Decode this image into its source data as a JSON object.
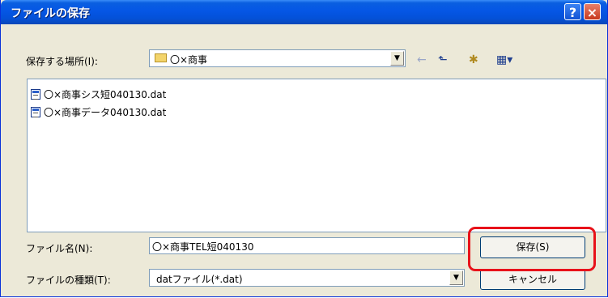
{
  "dialog": {
    "title": "ファイルの保存",
    "help_button": "?",
    "close_button": "×"
  },
  "location": {
    "label": "保存する場所(I):",
    "value": "〇×商事"
  },
  "toolbar": {
    "back_glyph": "←",
    "up_glyph": "⬑",
    "new_folder_glyph": "✱",
    "views_glyph": "▦▾"
  },
  "files": [
    {
      "name": "〇×商事シス短040130.dat"
    },
    {
      "name": "〇×商事データ040130.dat"
    }
  ],
  "filename": {
    "label": "ファイル名(N):",
    "value": "〇×商事TEL短040130"
  },
  "filetype": {
    "label": "ファイルの種類(T):",
    "value": "datファイル(*.dat)"
  },
  "buttons": {
    "save": "保存(S)",
    "cancel": "キャンセル"
  },
  "colors": {
    "titlebar": "#0556e5",
    "dialog_bg": "#ece9d8",
    "highlight": "#e8121a"
  }
}
